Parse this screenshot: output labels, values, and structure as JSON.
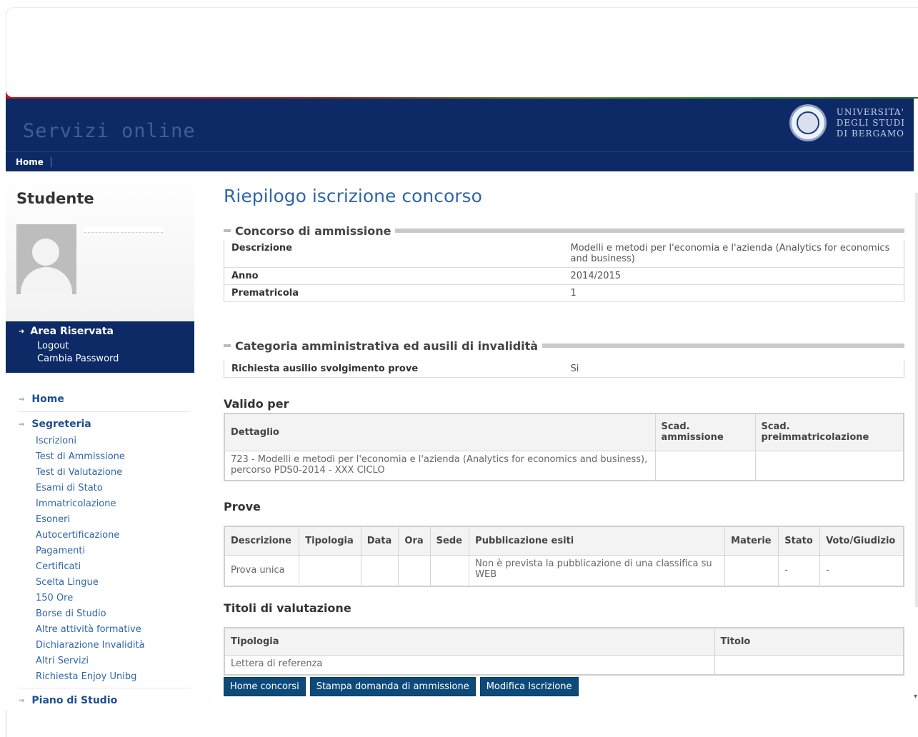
{
  "header": {
    "title": "Servizi online",
    "university": [
      "UNIVERSITA'",
      "DEGLI STUDI",
      "DI BERGAMO"
    ]
  },
  "navbar": {
    "home": "Home"
  },
  "sidebar": {
    "title": "Studente",
    "area": {
      "heading": "Area Riservata",
      "logout": "Logout",
      "change_password": "Cambia Password"
    },
    "home": "Home",
    "segreteria": {
      "label": "Segreteria",
      "items": [
        "Iscrizioni",
        "Test di Ammissione",
        "Test di Valutazione",
        "Esami di Stato",
        "Immatricolazione",
        "Esoneri",
        "Autocertificazione",
        "Pagamenti",
        "Certificati",
        "Scelta Lingue",
        "150 Ore",
        "Borse di Studio",
        "Altre attività formative",
        "Dichiarazione Invalidità",
        "Altri Servizi",
        "Richiesta Enjoy Unibg"
      ]
    },
    "piano": "Piano di Studio"
  },
  "main": {
    "title": "Riepilogo iscrizione concorso",
    "concorso": {
      "legend": "Concorso di ammissione",
      "rows": [
        {
          "key": "Descrizione",
          "value": "Modelli e metodi per l'economia e l'azienda (Analytics for economics and business)"
        },
        {
          "key": "Anno",
          "value": "2014/2015"
        },
        {
          "key": "Prematricola",
          "value": "1"
        }
      ]
    },
    "categoria": {
      "legend": "Categoria amministrativa ed ausili di invalidità",
      "rows": [
        {
          "key": "Richiesta ausilio svolgimento prove",
          "value": "Si"
        }
      ]
    },
    "valido": {
      "title": "Valido per",
      "headers": [
        "Dettaglio",
        "Scad. ammissione",
        "Scad. preimmatricolazione"
      ],
      "rows": [
        [
          "723 - Modelli e metodi per l'economia e l'azienda (Analytics for economics and business), percorso PDS0-2014 - XXX CICLO",
          "",
          ""
        ]
      ]
    },
    "prove": {
      "title": "Prove",
      "headers": [
        "Descrizione",
        "Tipologia",
        "Data",
        "Ora",
        "Sede",
        "Pubblicazione esiti",
        "Materie",
        "Stato",
        "Voto/Giudizio"
      ],
      "rows": [
        [
          "Prova unica",
          "",
          "",
          "",
          "",
          "Non è prevista la pubblicazione di una classifica su WEB",
          "",
          "-",
          "-"
        ]
      ]
    },
    "titoli": {
      "title": "Titoli di valutazione",
      "headers": [
        "Tipologia",
        "Titolo"
      ],
      "rows": [
        [
          "Lettera di referenza",
          ""
        ]
      ]
    },
    "buttons": {
      "home_concorsi": "Home concorsi",
      "stampa": "Stampa domanda di ammissione",
      "modifica": "Modifica Iscrizione"
    }
  }
}
